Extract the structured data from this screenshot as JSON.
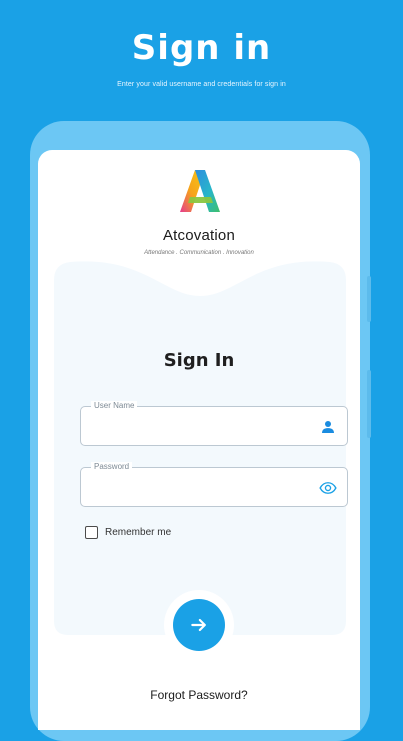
{
  "header": {
    "title": "Sign in",
    "subtitle": "Enter your valid username and credentials for sign in"
  },
  "brand": {
    "name": "Atcovation",
    "tagline": "Attendance . Communication . Innovation",
    "logo_icon": "atcovation-a-logo"
  },
  "form": {
    "heading": "Sign In",
    "username_label": "User Name",
    "username_value": "",
    "username_icon": "user-icon",
    "password_label": "Password",
    "password_value": "",
    "password_icon": "eye-icon",
    "remember_label": "Remember me",
    "remember_checked": false,
    "submit_icon": "arrow-right-icon",
    "forgot_password": "Forgot Password?"
  },
  "colors": {
    "background": "#1aa1e6",
    "phone_frame": "#6cc7f4",
    "card": "#f3f9fd",
    "accent": "#1aa1e6"
  }
}
